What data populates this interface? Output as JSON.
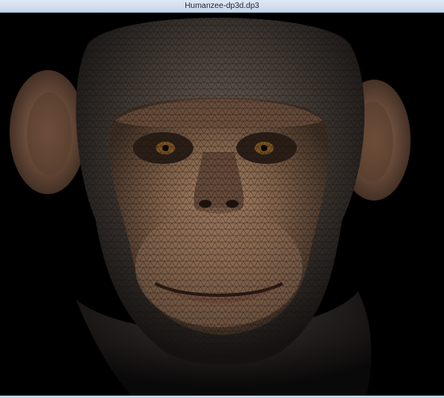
{
  "window": {
    "title": "Humanzee-dp3d.dp3"
  },
  "viewport": {
    "content": "wireframe-chimpanzee-head",
    "background_color": "#000000",
    "skin_color": "#8a6a50",
    "mesh_color": "#1a1410"
  }
}
